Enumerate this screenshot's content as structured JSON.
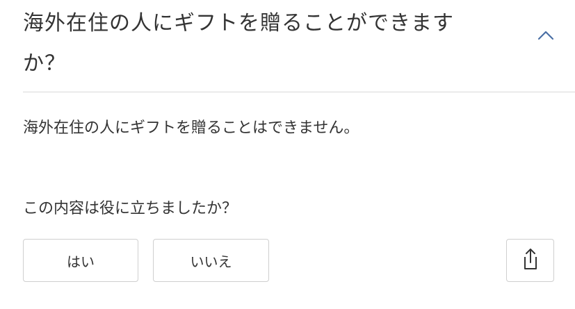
{
  "faq": {
    "question": "海外在住の人にギフトを贈ることができますか？",
    "collapse_icon": "chevron-up-icon",
    "answer": "海外在住の人にギフトを贈ることはできません。"
  },
  "feedback": {
    "prompt": "この内容は役に立ちましたか？",
    "yes_label": "はい",
    "no_label": "いいえ",
    "share_icon": "share-icon"
  },
  "colors": {
    "text": "#333333",
    "chevron": "#4a6fa5",
    "divider": "#d9d9d9",
    "button_border": "#cfcfcf"
  }
}
